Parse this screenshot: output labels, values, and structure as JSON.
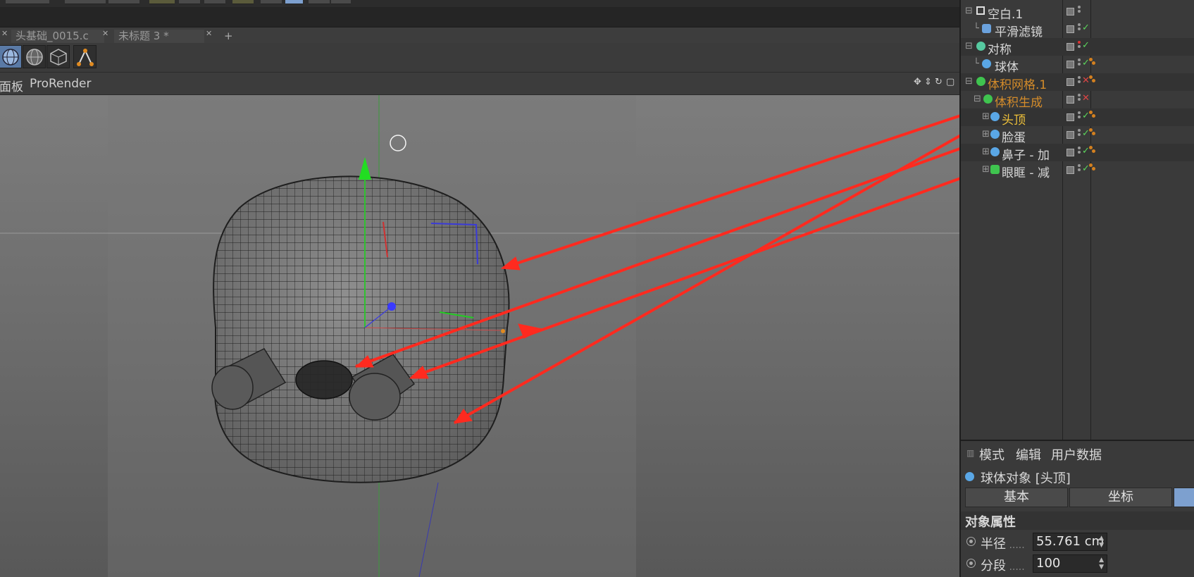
{
  "doc_tabs": [
    {
      "label": "头基础_0015.c"
    },
    {
      "label": "未标题 3 *"
    }
  ],
  "add_tab_label": "+",
  "viewport_menu": {
    "panel_label": "面板",
    "prorender_label": "ProRender"
  },
  "objects": [
    {
      "name": "空白.1",
      "icon": "null-icon",
      "style": "normal",
      "status": "none"
    },
    {
      "name": "平滑滤镜",
      "icon": "smoothing-deformer-icon",
      "style": "normal",
      "status": "check"
    },
    {
      "name": "对称",
      "icon": "symmetry-icon",
      "style": "normal",
      "status": "check"
    },
    {
      "name": "球体",
      "icon": "sphere-icon",
      "style": "normal",
      "status": "check"
    },
    {
      "name": "体积网格.1",
      "icon": "volume-mesher-icon",
      "style": "orange",
      "status": "cross"
    },
    {
      "name": "体积生成",
      "icon": "volume-builder-icon",
      "style": "orange",
      "status": "cross"
    },
    {
      "name": "头顶",
      "icon": "sphere-icon",
      "style": "yellow",
      "status": "check"
    },
    {
      "name": "脸蛋",
      "icon": "sphere-icon",
      "style": "normal",
      "status": "check"
    },
    {
      "name": "鼻子 - 加",
      "icon": "sphere-icon",
      "style": "normal",
      "status": "check"
    },
    {
      "name": "眼眶 - 减",
      "icon": "cylinder-icon",
      "style": "normal",
      "status": "check"
    }
  ],
  "attr_menu": {
    "mode": "模式",
    "edit": "编辑",
    "user_data": "用户数据"
  },
  "attr_title": "球体对象 [头顶]",
  "attr_tabs": [
    {
      "label": "基本"
    },
    {
      "label": "坐标"
    },
    {
      "label": ""
    }
  ],
  "attr_section": "对象属性",
  "attr_fields": [
    {
      "label": "半径",
      "dots": " .....",
      "value": "55.761 cm"
    },
    {
      "label": "分段",
      "dots": " .....",
      "value": "100"
    }
  ],
  "colors": {
    "accent_blue": "#7da0cf",
    "annotation_red": "#ff2a1f",
    "orange_text": "#d38b2a",
    "selected_text": "#f0c23a"
  }
}
